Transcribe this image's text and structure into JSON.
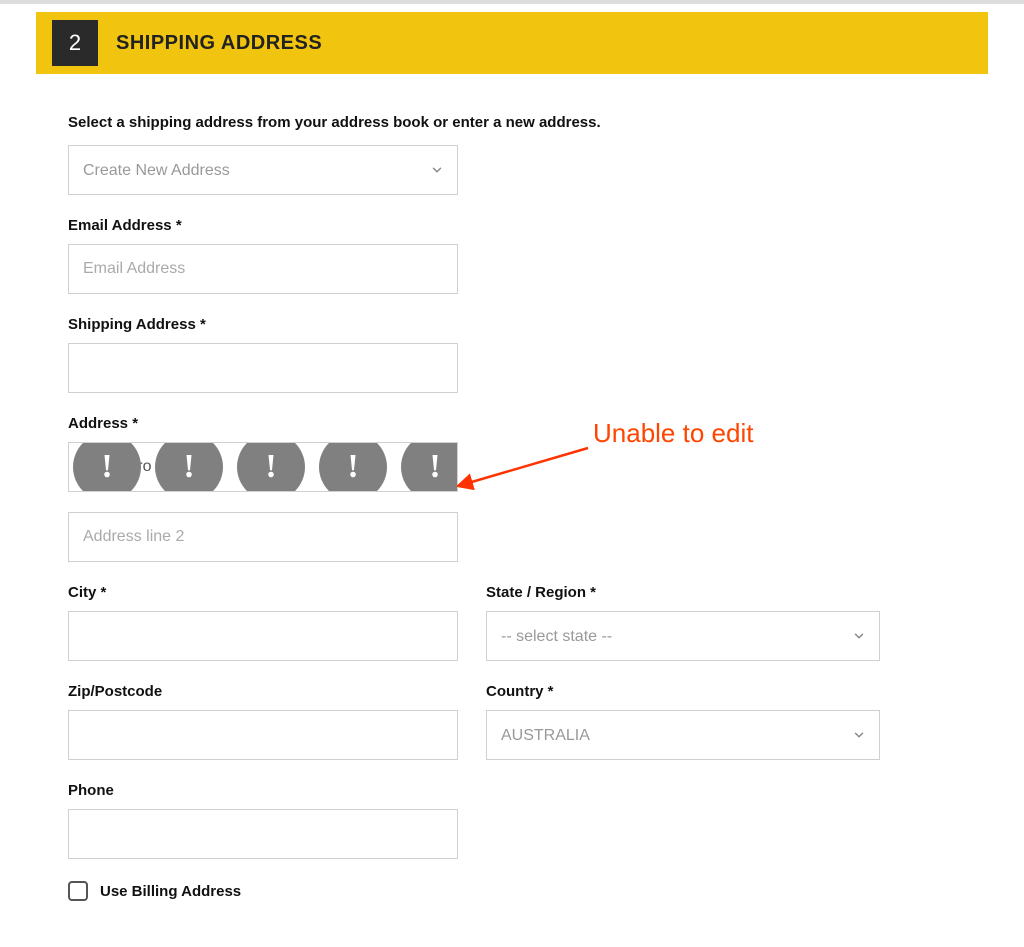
{
  "header": {
    "step": "2",
    "title": "SHIPPING ADDRESS"
  },
  "form": {
    "instruction": "Select a shipping address from your address book or enter a new address.",
    "address_book": {
      "selected": "Create New Address"
    },
    "fields": {
      "email": {
        "label": "Email Address *",
        "placeholder": "Email Address"
      },
      "shipping_address": {
        "label": "Shipping Address *"
      },
      "address": {
        "label": "Address *",
        "line1_text": "  Se    ng    yro",
        "line2_placeholder": "Address line 2"
      },
      "city": {
        "label": "City *"
      },
      "state": {
        "label": "State / Region *",
        "selected": "-- select state --"
      },
      "zip": {
        "label": "Zip/Postcode"
      },
      "country": {
        "label": "Country *",
        "selected": "AUSTRALIA"
      },
      "phone": {
        "label": "Phone"
      },
      "use_billing": {
        "label": "Use Billing Address",
        "checked": false
      }
    }
  },
  "annotation": {
    "text": "Unable to edit"
  },
  "icons": {
    "chevron": "chevron-down-icon",
    "warning": "warning-bubble-icon"
  }
}
